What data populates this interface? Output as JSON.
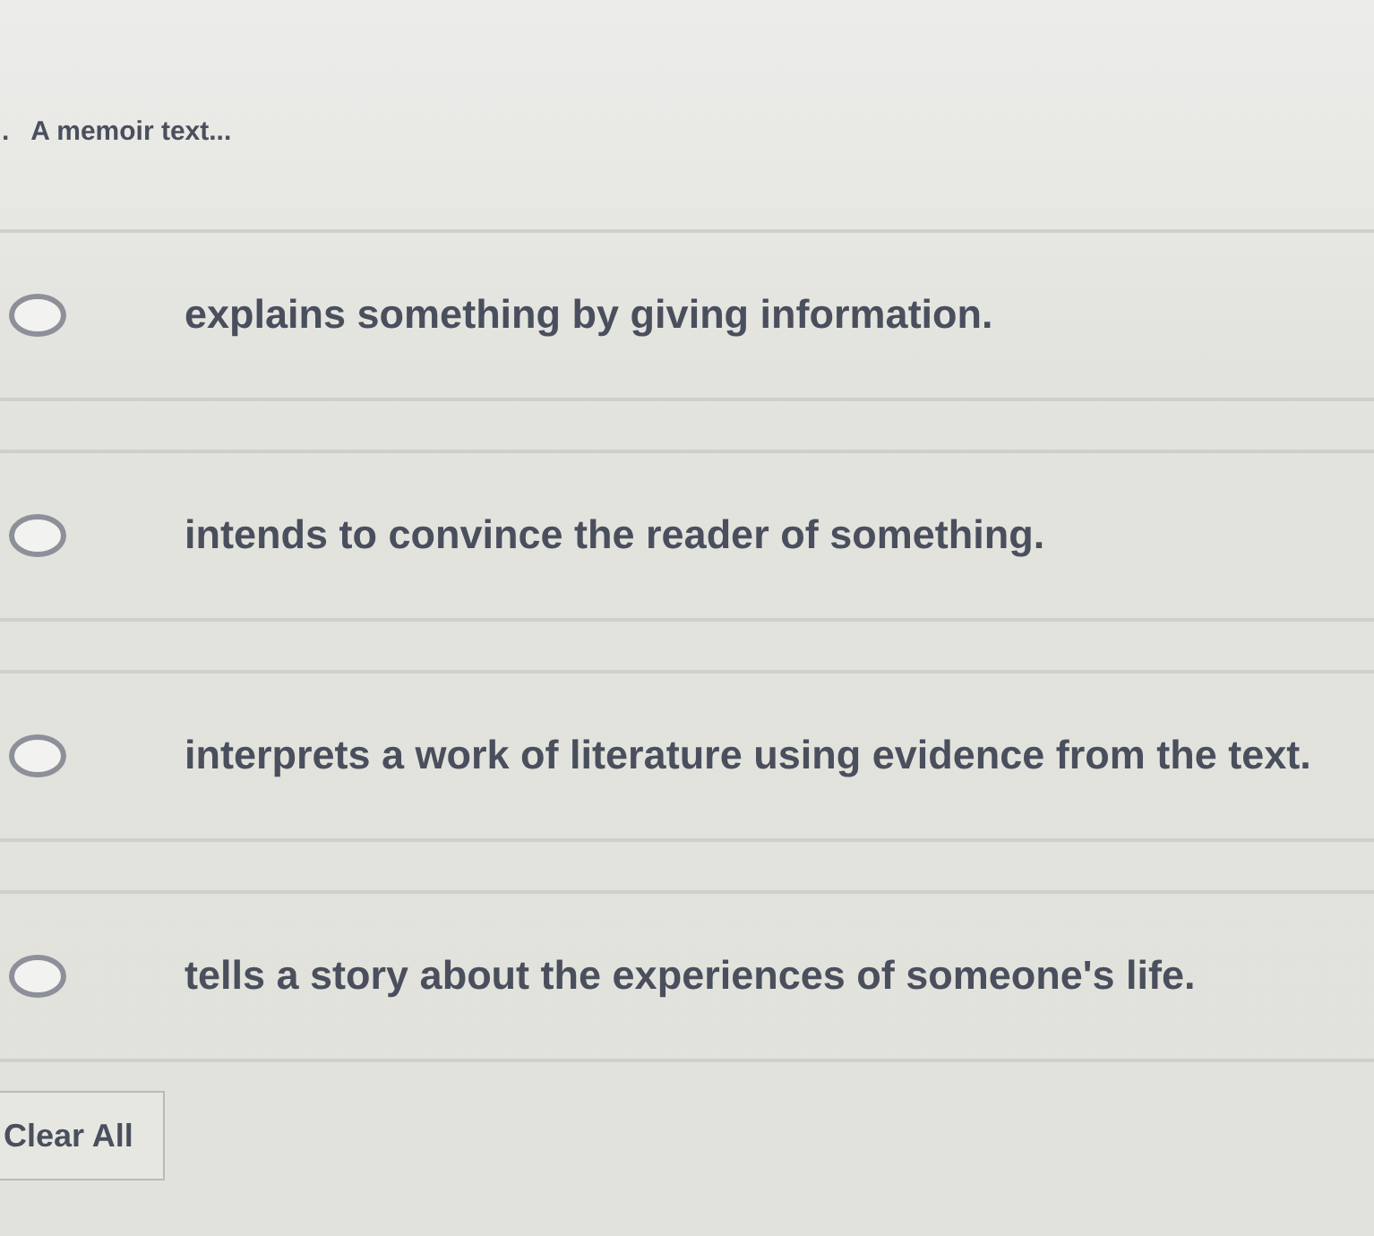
{
  "question": {
    "number": ".",
    "text": "A memoir text..."
  },
  "options": [
    {
      "label": "explains something by giving information.",
      "selected": false
    },
    {
      "label": "intends to convince the reader of something.",
      "selected": false
    },
    {
      "label": "interprets a work of literature using evidence from the text.",
      "selected": false
    },
    {
      "label": "tells a story about the experiences of someone's life.",
      "selected": false
    }
  ],
  "clear_button": {
    "label": "Clear All"
  }
}
